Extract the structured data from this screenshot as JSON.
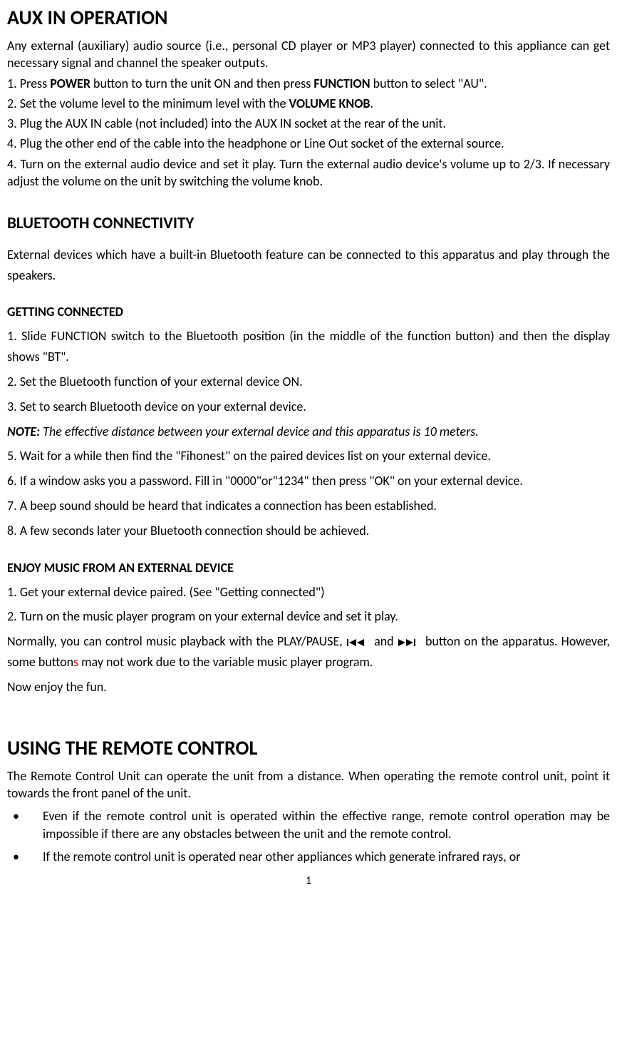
{
  "section1": {
    "title": "AUX IN OPERATION",
    "intro": "Any external (auxiliary) audio source (i.e., personal CD player or MP3 player) connected to this appliance can get necessary signal and channel the speaker outputs.",
    "step1_pre": "1. Press ",
    "step1_bold1": "POWER",
    "step1_mid": " button to turn the unit ON and then press ",
    "step1_bold2": "FUNCTION",
    "step1_post": " button to select \"AU\".",
    "step2_pre": "2. Set the volume level to the minimum level with the ",
    "step2_bold": "VOLUME KNOB",
    "step2_post": ".",
    "step3": "3. Plug the AUX IN cable (not included) into the AUX IN socket at the rear of the unit.",
    "step4a": "4. Plug the other end of the cable into the headphone or Line Out socket of the external source.",
    "step4b": "4. Turn on the external audio device and set it play. Turn the external audio device's volume up to 2/3. If necessary adjust the volume on the unit by switching the volume knob."
  },
  "section2": {
    "title": "BLUETOOTH CONNECTIVITY",
    "intro": "External devices which have a built-in Bluetooth feature can be connected to this apparatus and play through the speakers.",
    "sub1_title": "GETTING CONNECTED",
    "s1": "1. Slide FUNCTION switch to the Bluetooth position (in the middle of the function button) and then the display shows \"BT\".",
    "s2": "2. Set the Bluetooth function of your external device ON.",
    "s3": "3. Set to search Bluetooth device on your external device.",
    "note_label": "NOTE:",
    "note_text": " The effective distance between your external device and this apparatus is 10 meters.",
    "s5": "5. Wait for a while then find the \"Fihonest\" on the paired devices list on your external device.",
    "s6": "6. If a window asks you a password. Fill in \"0000\"or\"1234\" then press \"OK\" on your external device.",
    "s7": "7. A beep sound should be heard that indicates a connection has been established.",
    "s8": "8. A few seconds later your Bluetooth connection should be achieved.",
    "sub2_title": "ENJOY MUSIC FROM AN EXTERNAL DEVICE",
    "e1": "1. Get your external device paired. (See \"Getting connected\")",
    "e2": "2. Turn on the music player program on your external device and set it play.",
    "e3_pre": "Normally, you can control music playback with the PLAY/PAUSE, ",
    "e3_mid": " and ",
    "e3_post": " button on the apparatus. However, some button",
    "e3_red": "s",
    "e3_post2": " may not work due to the variable music player program.",
    "e4": "Now enjoy the fun."
  },
  "section3": {
    "title": "USING THE REMOTE CONTROL",
    "intro": "The Remote Control Unit can operate the unit from a distance. When operating the remote control unit, point it towards the front panel of the unit.",
    "b1": "Even if the remote control unit is operated within the effective range, remote control operation may be impossible if there are any obstacles between the unit and the remote control.",
    "b2": "If the remote control unit is operated near other appliances which generate infrared rays, or"
  },
  "page_number": "1"
}
